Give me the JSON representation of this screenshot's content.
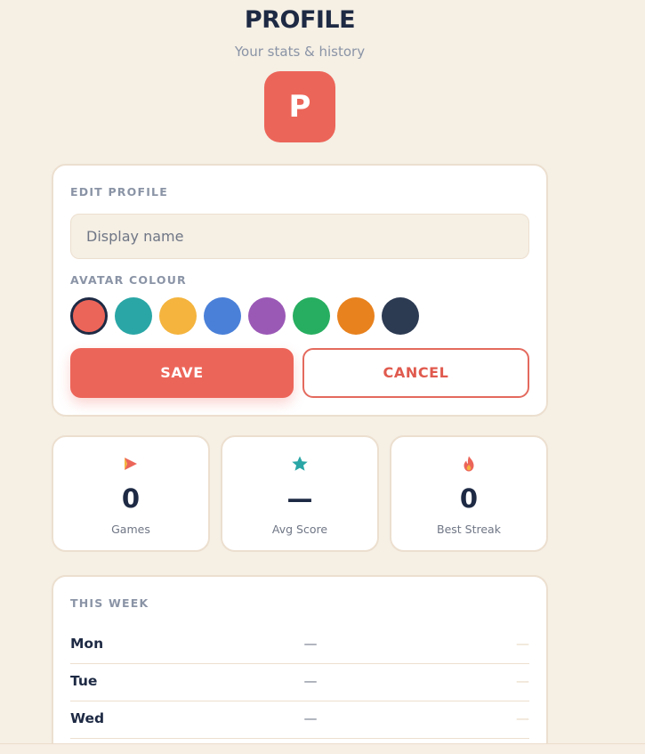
{
  "header": {
    "title": "PROFILE",
    "subtitle": "Your stats & history",
    "avatar_initial": "P",
    "avatar_color": "#ec6559"
  },
  "edit_profile": {
    "label": "EDIT PROFILE",
    "name_placeholder": "Display name",
    "name_value": "",
    "colour_label": "AVATAR COLOUR",
    "colours": [
      "#ec6559",
      "#2aa6a6",
      "#f4b43e",
      "#4a80d8",
      "#9b59b6",
      "#27ae60",
      "#e8821e",
      "#2c3a52"
    ],
    "selected_colour_index": 0,
    "save_label": "SAVE",
    "cancel_label": "CANCEL"
  },
  "stats": [
    {
      "icon": "play-arrow-icon",
      "value": "0",
      "label": "Games",
      "icon_color": "#ec6559"
    },
    {
      "icon": "star-icon",
      "value": "—",
      "label": "Avg Score",
      "icon_color": "#2aa6a6"
    },
    {
      "icon": "flame-icon",
      "value": "0",
      "label": "Best Streak",
      "icon_color": "#ec6559"
    }
  ],
  "week": {
    "label": "THIS WEEK",
    "rows": [
      {
        "day": "Mon",
        "score": "—",
        "extra": "—"
      },
      {
        "day": "Tue",
        "score": "—",
        "extra": "—"
      },
      {
        "day": "Wed",
        "score": "—",
        "extra": "—"
      }
    ]
  }
}
